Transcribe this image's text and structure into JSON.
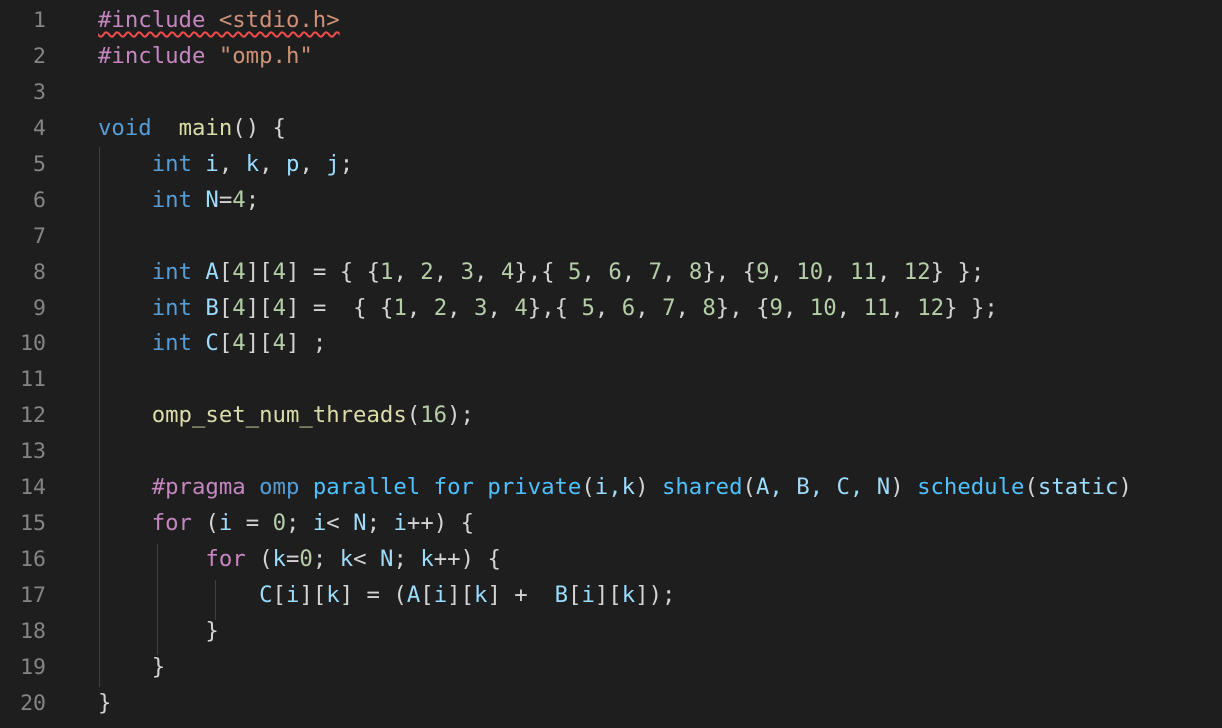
{
  "editor": {
    "line_numbers": [
      "1",
      "2",
      "3",
      "4",
      "5",
      "6",
      "7",
      "8",
      "9",
      "10",
      "11",
      "12",
      "13",
      "14",
      "15",
      "16",
      "17",
      "18",
      "19",
      "20"
    ],
    "colors": {
      "background": "#1e1e1e",
      "line_number": "#858585",
      "keyword_control": "#c586c0",
      "type": "#569cd6",
      "variable": "#9cdcfe",
      "number": "#b5cea8",
      "string": "#ce9178",
      "function": "#dcdcaa",
      "error_squiggle": "#f14c4c"
    },
    "lines": [
      [
        {
          "t": "#include ",
          "c": "tok-macro",
          "sq": true
        },
        {
          "t": "<stdio.h>",
          "c": "tok-include",
          "sq": true
        }
      ],
      [
        {
          "t": "#include ",
          "c": "tok-macro"
        },
        {
          "t": "\"omp.h\"",
          "c": "tok-string"
        }
      ],
      [],
      [
        {
          "t": "void",
          "c": "tok-type"
        },
        {
          "t": "  ",
          "c": "tok-punc"
        },
        {
          "t": "main",
          "c": "tok-func"
        },
        {
          "t": "() {",
          "c": "tok-punc"
        }
      ],
      [
        {
          "t": "    ",
          "c": "tok-punc"
        },
        {
          "t": "int",
          "c": "tok-type"
        },
        {
          "t": " ",
          "c": "tok-punc"
        },
        {
          "t": "i",
          "c": "tok-var"
        },
        {
          "t": ", ",
          "c": "tok-punc"
        },
        {
          "t": "k",
          "c": "tok-var"
        },
        {
          "t": ", ",
          "c": "tok-punc"
        },
        {
          "t": "p",
          "c": "tok-var"
        },
        {
          "t": ", ",
          "c": "tok-punc"
        },
        {
          "t": "j",
          "c": "tok-var"
        },
        {
          "t": ";",
          "c": "tok-punc"
        }
      ],
      [
        {
          "t": "    ",
          "c": "tok-punc"
        },
        {
          "t": "int",
          "c": "tok-type"
        },
        {
          "t": " ",
          "c": "tok-punc"
        },
        {
          "t": "N",
          "c": "tok-var"
        },
        {
          "t": "=",
          "c": "tok-punc"
        },
        {
          "t": "4",
          "c": "tok-num"
        },
        {
          "t": ";",
          "c": "tok-punc"
        }
      ],
      [],
      [
        {
          "t": "    ",
          "c": "tok-punc"
        },
        {
          "t": "int",
          "c": "tok-type"
        },
        {
          "t": " ",
          "c": "tok-punc"
        },
        {
          "t": "A",
          "c": "tok-var"
        },
        {
          "t": "[",
          "c": "tok-punc"
        },
        {
          "t": "4",
          "c": "tok-num"
        },
        {
          "t": "][",
          "c": "tok-punc"
        },
        {
          "t": "4",
          "c": "tok-num"
        },
        {
          "t": "] = { {",
          "c": "tok-punc"
        },
        {
          "t": "1",
          "c": "tok-num"
        },
        {
          "t": ", ",
          "c": "tok-punc"
        },
        {
          "t": "2",
          "c": "tok-num"
        },
        {
          "t": ", ",
          "c": "tok-punc"
        },
        {
          "t": "3",
          "c": "tok-num"
        },
        {
          "t": ", ",
          "c": "tok-punc"
        },
        {
          "t": "4",
          "c": "tok-num"
        },
        {
          "t": "},{ ",
          "c": "tok-punc"
        },
        {
          "t": "5",
          "c": "tok-num"
        },
        {
          "t": ", ",
          "c": "tok-punc"
        },
        {
          "t": "6",
          "c": "tok-num"
        },
        {
          "t": ", ",
          "c": "tok-punc"
        },
        {
          "t": "7",
          "c": "tok-num"
        },
        {
          "t": ", ",
          "c": "tok-punc"
        },
        {
          "t": "8",
          "c": "tok-num"
        },
        {
          "t": "}, {",
          "c": "tok-punc"
        },
        {
          "t": "9",
          "c": "tok-num"
        },
        {
          "t": ", ",
          "c": "tok-punc"
        },
        {
          "t": "10",
          "c": "tok-num"
        },
        {
          "t": ", ",
          "c": "tok-punc"
        },
        {
          "t": "11",
          "c": "tok-num"
        },
        {
          "t": ", ",
          "c": "tok-punc"
        },
        {
          "t": "12",
          "c": "tok-num"
        },
        {
          "t": "} };",
          "c": "tok-punc"
        }
      ],
      [
        {
          "t": "    ",
          "c": "tok-punc"
        },
        {
          "t": "int",
          "c": "tok-type"
        },
        {
          "t": " ",
          "c": "tok-punc"
        },
        {
          "t": "B",
          "c": "tok-var"
        },
        {
          "t": "[",
          "c": "tok-punc"
        },
        {
          "t": "4",
          "c": "tok-num"
        },
        {
          "t": "][",
          "c": "tok-punc"
        },
        {
          "t": "4",
          "c": "tok-num"
        },
        {
          "t": "] =  { {",
          "c": "tok-punc"
        },
        {
          "t": "1",
          "c": "tok-num"
        },
        {
          "t": ", ",
          "c": "tok-punc"
        },
        {
          "t": "2",
          "c": "tok-num"
        },
        {
          "t": ", ",
          "c": "tok-punc"
        },
        {
          "t": "3",
          "c": "tok-num"
        },
        {
          "t": ", ",
          "c": "tok-punc"
        },
        {
          "t": "4",
          "c": "tok-num"
        },
        {
          "t": "},{ ",
          "c": "tok-punc"
        },
        {
          "t": "5",
          "c": "tok-num"
        },
        {
          "t": ", ",
          "c": "tok-punc"
        },
        {
          "t": "6",
          "c": "tok-num"
        },
        {
          "t": ", ",
          "c": "tok-punc"
        },
        {
          "t": "7",
          "c": "tok-num"
        },
        {
          "t": ", ",
          "c": "tok-punc"
        },
        {
          "t": "8",
          "c": "tok-num"
        },
        {
          "t": "}, {",
          "c": "tok-punc"
        },
        {
          "t": "9",
          "c": "tok-num"
        },
        {
          "t": ", ",
          "c": "tok-punc"
        },
        {
          "t": "10",
          "c": "tok-num"
        },
        {
          "t": ", ",
          "c": "tok-punc"
        },
        {
          "t": "11",
          "c": "tok-num"
        },
        {
          "t": ", ",
          "c": "tok-punc"
        },
        {
          "t": "12",
          "c": "tok-num"
        },
        {
          "t": "} };",
          "c": "tok-punc"
        }
      ],
      [
        {
          "t": "    ",
          "c": "tok-punc"
        },
        {
          "t": "int",
          "c": "tok-type"
        },
        {
          "t": " ",
          "c": "tok-punc"
        },
        {
          "t": "C",
          "c": "tok-var"
        },
        {
          "t": "[",
          "c": "tok-punc"
        },
        {
          "t": "4",
          "c": "tok-num"
        },
        {
          "t": "][",
          "c": "tok-punc"
        },
        {
          "t": "4",
          "c": "tok-num"
        },
        {
          "t": "] ;",
          "c": "tok-punc"
        }
      ],
      [],
      [
        {
          "t": "    ",
          "c": "tok-punc"
        },
        {
          "t": "omp_set_num_threads",
          "c": "tok-func"
        },
        {
          "t": "(",
          "c": "tok-punc"
        },
        {
          "t": "16",
          "c": "tok-num"
        },
        {
          "t": ");",
          "c": "tok-punc"
        }
      ],
      [],
      [
        {
          "t": "    ",
          "c": "tok-punc"
        },
        {
          "t": "#pragma",
          "c": "tok-pragma"
        },
        {
          "t": " ",
          "c": "tok-punc"
        },
        {
          "t": "omp",
          "c": "tok-pragkw"
        },
        {
          "t": " ",
          "c": "tok-punc"
        },
        {
          "t": "parallel",
          "c": "tok-pragid"
        },
        {
          "t": " ",
          "c": "tok-punc"
        },
        {
          "t": "for",
          "c": "tok-pragid"
        },
        {
          "t": " ",
          "c": "tok-punc"
        },
        {
          "t": "private",
          "c": "tok-pragclause"
        },
        {
          "t": "(",
          "c": "tok-punc"
        },
        {
          "t": "i,k",
          "c": "tok-pragarg"
        },
        {
          "t": ")",
          "c": "tok-punc"
        },
        {
          "t": " ",
          "c": "tok-punc"
        },
        {
          "t": "shared",
          "c": "tok-pragclause"
        },
        {
          "t": "(",
          "c": "tok-punc"
        },
        {
          "t": "A, B, C, N",
          "c": "tok-pragarg"
        },
        {
          "t": ")",
          "c": "tok-punc"
        },
        {
          "t": " ",
          "c": "tok-punc"
        },
        {
          "t": "schedule",
          "c": "tok-pragclause"
        },
        {
          "t": "(",
          "c": "tok-punc"
        },
        {
          "t": "static",
          "c": "tok-pragarg"
        },
        {
          "t": ")",
          "c": "tok-punc"
        }
      ],
      [
        {
          "t": "    ",
          "c": "tok-punc"
        },
        {
          "t": "for",
          "c": "tok-ctrl"
        },
        {
          "t": " (",
          "c": "tok-punc"
        },
        {
          "t": "i",
          "c": "tok-var"
        },
        {
          "t": " = ",
          "c": "tok-punc"
        },
        {
          "t": "0",
          "c": "tok-num"
        },
        {
          "t": "; ",
          "c": "tok-punc"
        },
        {
          "t": "i",
          "c": "tok-var"
        },
        {
          "t": "< ",
          "c": "tok-punc"
        },
        {
          "t": "N",
          "c": "tok-var"
        },
        {
          "t": "; ",
          "c": "tok-punc"
        },
        {
          "t": "i",
          "c": "tok-var"
        },
        {
          "t": "++) {",
          "c": "tok-punc"
        }
      ],
      [
        {
          "t": "        ",
          "c": "tok-punc"
        },
        {
          "t": "for",
          "c": "tok-ctrl"
        },
        {
          "t": " (",
          "c": "tok-punc"
        },
        {
          "t": "k",
          "c": "tok-var"
        },
        {
          "t": "=",
          "c": "tok-punc"
        },
        {
          "t": "0",
          "c": "tok-num"
        },
        {
          "t": "; ",
          "c": "tok-punc"
        },
        {
          "t": "k",
          "c": "tok-var"
        },
        {
          "t": "< ",
          "c": "tok-punc"
        },
        {
          "t": "N",
          "c": "tok-var"
        },
        {
          "t": "; ",
          "c": "tok-punc"
        },
        {
          "t": "k",
          "c": "tok-var"
        },
        {
          "t": "++) {",
          "c": "tok-punc"
        }
      ],
      [
        {
          "t": "            ",
          "c": "tok-punc"
        },
        {
          "t": "C",
          "c": "tok-var"
        },
        {
          "t": "[",
          "c": "tok-punc"
        },
        {
          "t": "i",
          "c": "tok-var"
        },
        {
          "t": "][",
          "c": "tok-punc"
        },
        {
          "t": "k",
          "c": "tok-var"
        },
        {
          "t": "] = (",
          "c": "tok-punc"
        },
        {
          "t": "A",
          "c": "tok-var"
        },
        {
          "t": "[",
          "c": "tok-punc"
        },
        {
          "t": "i",
          "c": "tok-var"
        },
        {
          "t": "][",
          "c": "tok-punc"
        },
        {
          "t": "k",
          "c": "tok-var"
        },
        {
          "t": "] +  ",
          "c": "tok-punc"
        },
        {
          "t": "B",
          "c": "tok-var"
        },
        {
          "t": "[",
          "c": "tok-punc"
        },
        {
          "t": "i",
          "c": "tok-var"
        },
        {
          "t": "][",
          "c": "tok-punc"
        },
        {
          "t": "k",
          "c": "tok-var"
        },
        {
          "t": "]);",
          "c": "tok-punc"
        }
      ],
      [
        {
          "t": "        }",
          "c": "tok-punc"
        }
      ],
      [
        {
          "t": "    }",
          "c": "tok-punc"
        }
      ],
      [
        {
          "t": "}",
          "c": "tok-punc"
        }
      ]
    ]
  }
}
